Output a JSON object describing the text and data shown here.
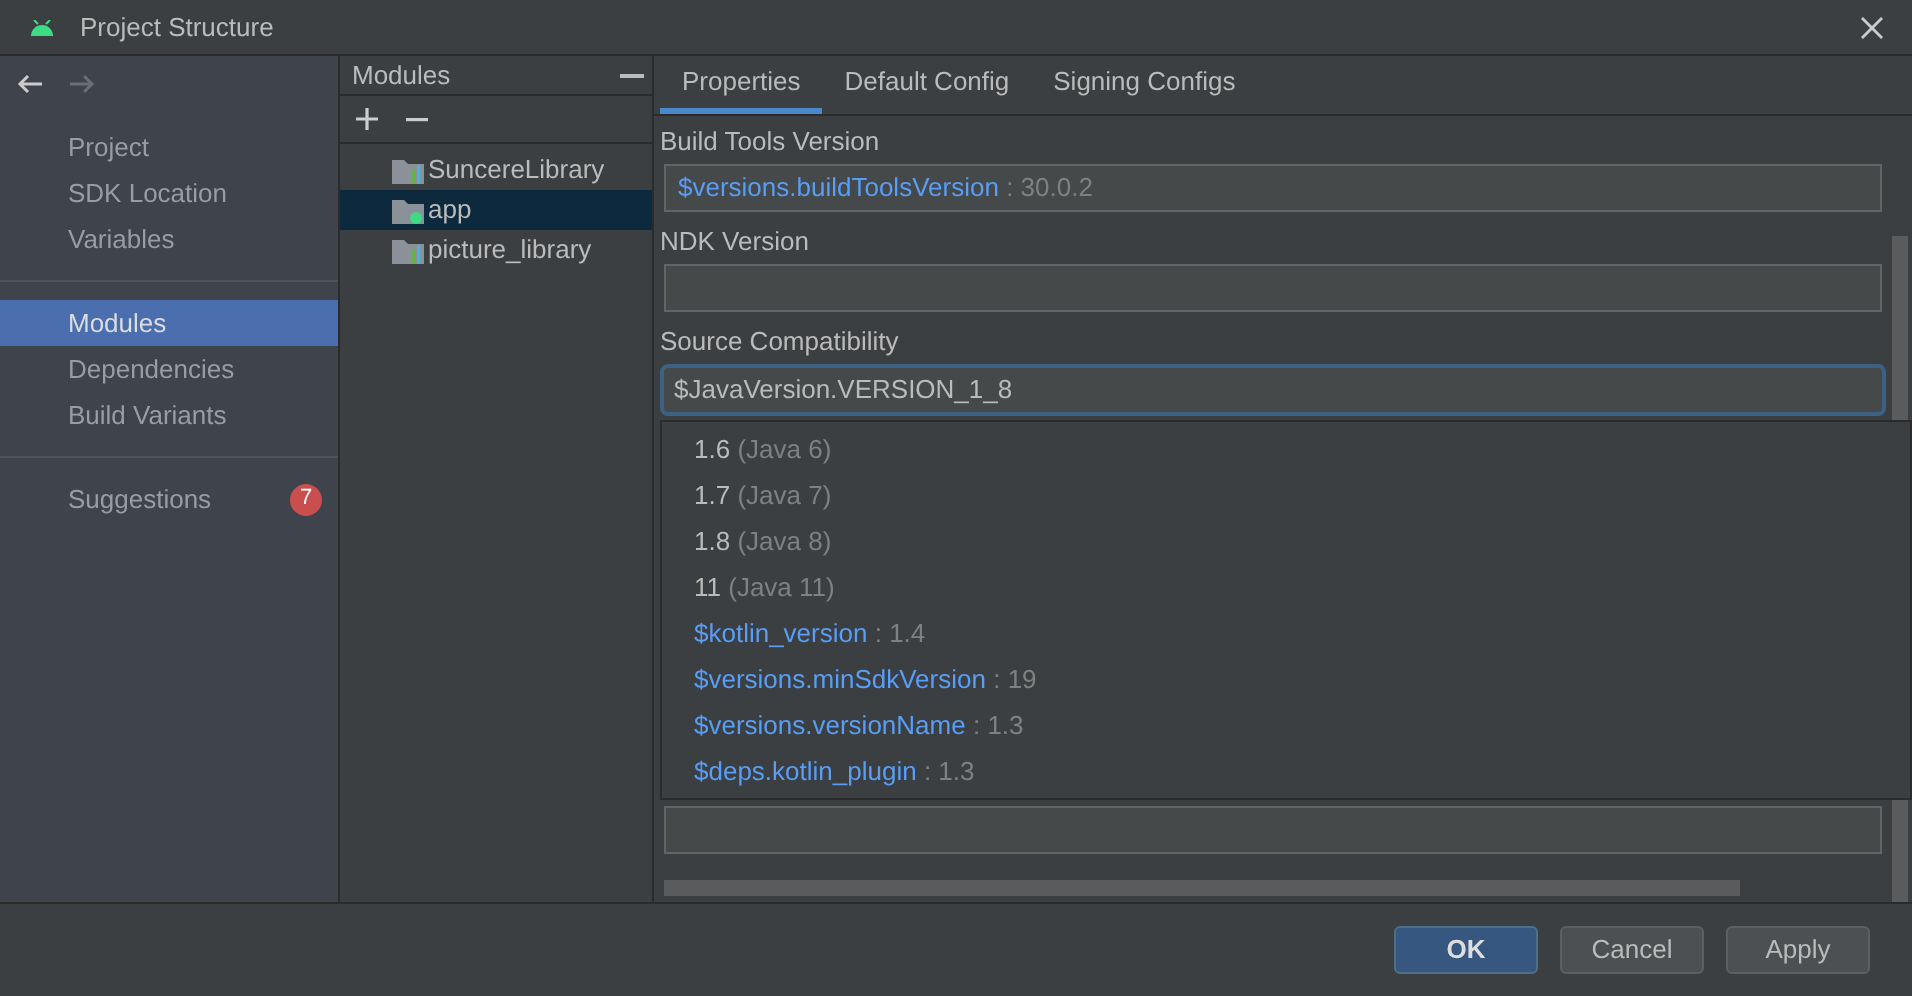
{
  "window": {
    "title": "Project Structure"
  },
  "sidebar": {
    "groups": [
      [
        {
          "label": "Project",
          "selected": false
        },
        {
          "label": "SDK Location",
          "selected": false
        },
        {
          "label": "Variables",
          "selected": false
        }
      ],
      [
        {
          "label": "Modules",
          "selected": true
        },
        {
          "label": "Dependencies",
          "selected": false
        },
        {
          "label": "Build Variants",
          "selected": false
        }
      ],
      [
        {
          "label": "Suggestions",
          "selected": false,
          "badge": "7"
        }
      ]
    ]
  },
  "modules": {
    "title": "Modules",
    "items": [
      {
        "name": "SuncereLibrary",
        "kind": "library",
        "selected": false
      },
      {
        "name": "app",
        "kind": "app",
        "selected": true
      },
      {
        "name": "picture_library",
        "kind": "library",
        "selected": false
      }
    ]
  },
  "tabs": [
    {
      "label": "Properties",
      "selected": true
    },
    {
      "label": "Default Config",
      "selected": false
    },
    {
      "label": "Signing Configs",
      "selected": false
    }
  ],
  "fields": [
    {
      "label": "Build Tools Version",
      "variable": "$versions.buildToolsVersion",
      "value": ": 30.0.2",
      "focused": false
    },
    {
      "label": "NDK Version",
      "focused": false
    },
    {
      "label": "Source Compatibility",
      "text": "$JavaVersion.VERSION_1_8",
      "focused": true,
      "options": [
        {
          "kind": "java",
          "text": "1.6",
          "hint": "(Java 6)"
        },
        {
          "kind": "java",
          "text": "1.7",
          "hint": "(Java 7)"
        },
        {
          "kind": "java",
          "text": "1.8",
          "hint": "(Java 8)"
        },
        {
          "kind": "java",
          "text": "11",
          "hint": "(Java 11)"
        },
        {
          "kind": "variable",
          "text": "$kotlin_version",
          "hint": ": 1.4"
        },
        {
          "kind": "variable",
          "text": "$versions.minSdkVersion",
          "hint": ": 19"
        },
        {
          "kind": "variable",
          "text": "$versions.versionName",
          "hint": ": 1.3"
        },
        {
          "kind": "variable",
          "text": "$deps.kotlin_plugin",
          "hint": ": 1.3"
        }
      ]
    },
    {
      "focused": false
    }
  ],
  "buttons": [
    {
      "label": "OK",
      "kind": "primary"
    },
    {
      "label": "Cancel",
      "kind": "secondary"
    },
    {
      "label": "Apply",
      "kind": "secondary"
    }
  ]
}
